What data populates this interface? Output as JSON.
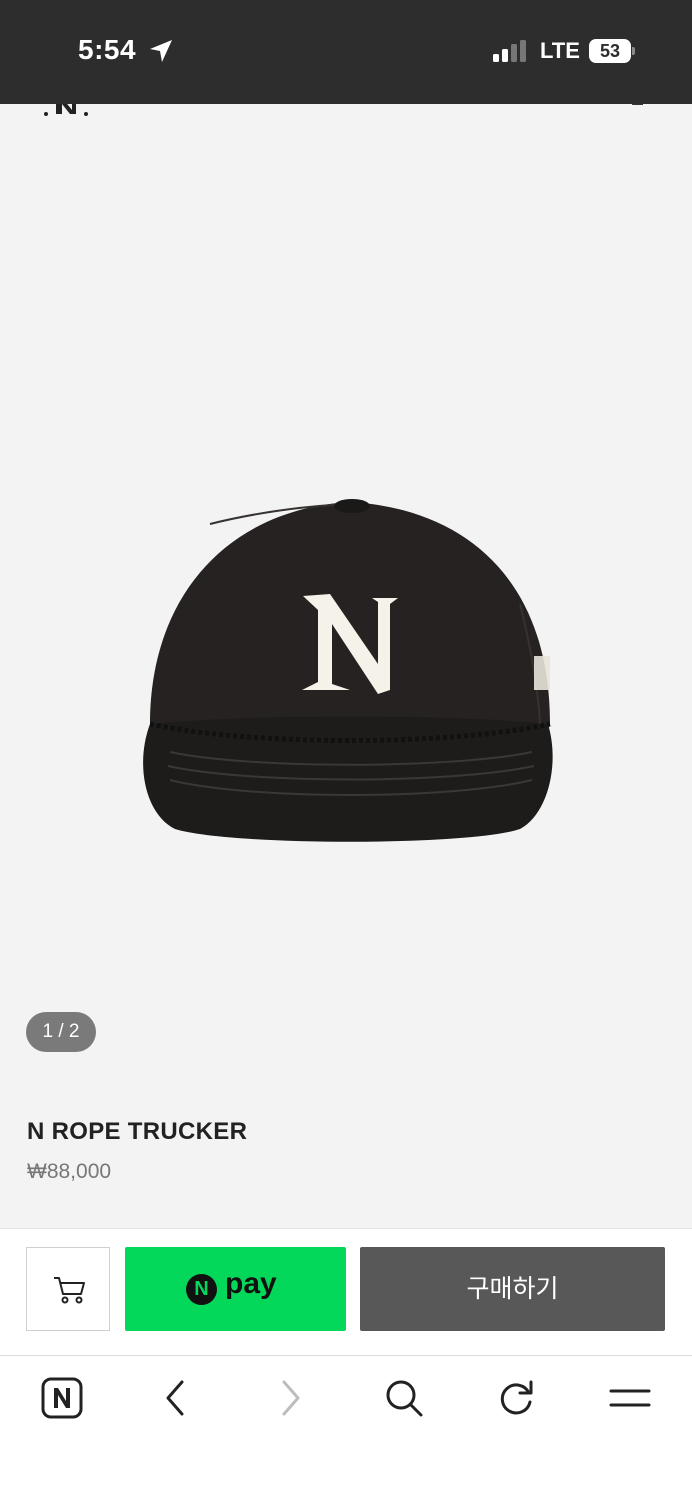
{
  "status_bar": {
    "time": "5:54",
    "network": "LTE",
    "battery": "53"
  },
  "product": {
    "image_counter": "1 / 2",
    "name": "N ROPE TRUCKER",
    "price": "₩88,000",
    "logo_letter": "N"
  },
  "actions": {
    "npay_logo_letter": "N",
    "npay_label": "pay",
    "buy_label": "구매하기"
  },
  "colors": {
    "npay_green": "#03d85a",
    "buy_button": "#585858",
    "status_bar": "#2d2d2d"
  },
  "browser_nav": {
    "icons": [
      "naver-home-icon",
      "back-icon",
      "forward-icon",
      "search-icon",
      "refresh-icon",
      "menu-icon"
    ],
    "home_letter": "N"
  }
}
